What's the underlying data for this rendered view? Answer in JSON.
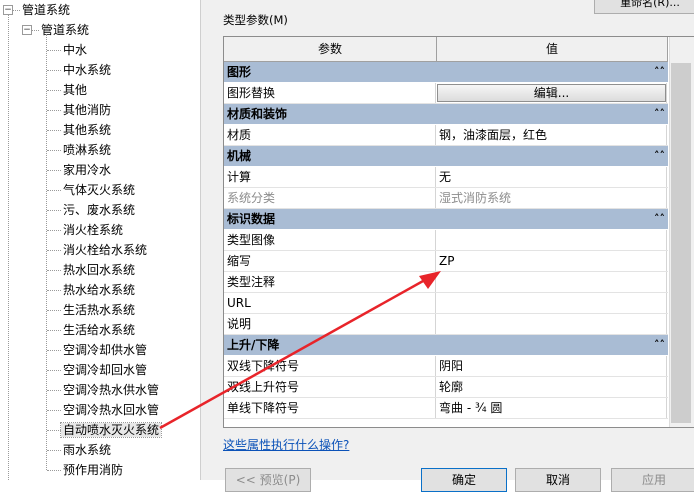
{
  "tree": {
    "root_label": "管道系统",
    "category_label": "管道系统",
    "items": [
      "中水",
      "中水系统",
      "其他",
      "其他消防",
      "其他系统",
      "喷淋系统",
      "家用冷水",
      "气体灭火系统",
      "污、废水系统",
      "消火栓系统",
      "消火栓给水系统",
      "热水回水系统",
      "热水给水系统",
      "生活热水系统",
      "生活给水系统",
      "空调冷却供水管",
      "空调冷却回水管",
      "空调冷热水供水管",
      "空调冷热水回水管",
      "自动喷水灭火系统",
      "雨水系统",
      "预作用消防"
    ],
    "selected_index": 19
  },
  "dialog": {
    "rename_button": "重命名(R)...",
    "type_params_label": "类型参数(M)",
    "grid": {
      "header_param": "参数",
      "header_value": "值",
      "header_extra": "=",
      "groups": [
        {
          "title": "图形",
          "rows": [
            {
              "param": "图形替换",
              "value": "编辑...",
              "is_button": true
            }
          ]
        },
        {
          "title": "材质和装饰",
          "rows": [
            {
              "param": "材质",
              "value": "钢，油漆面层，红色"
            }
          ]
        },
        {
          "title": "机械",
          "rows": [
            {
              "param": "计算",
              "value": "无"
            },
            {
              "param": "系统分类",
              "value": "湿式消防系统",
              "disabled": true
            }
          ]
        },
        {
          "title": "标识数据",
          "rows": [
            {
              "param": "类型图像",
              "value": ""
            },
            {
              "param": "缩写",
              "value": "ZP"
            },
            {
              "param": "类型注释",
              "value": ""
            },
            {
              "param": "URL",
              "value": ""
            },
            {
              "param": "说明",
              "value": ""
            }
          ]
        },
        {
          "title": "上升/下降",
          "rows": [
            {
              "param": "双线下降符号",
              "value": "阴阳"
            },
            {
              "param": "双线上升符号",
              "value": "轮廓"
            },
            {
              "param": "单线下降符号",
              "value": "弯曲 - ¾ 圆"
            }
          ]
        }
      ]
    },
    "help_link": "这些属性执行什么操作?",
    "buttons": {
      "preview": "<< 预览(P)",
      "ok": "确定",
      "cancel": "取消",
      "apply": "应用"
    }
  },
  "colors": {
    "group_header": "#a9bcd4",
    "arrow": "#e8242a",
    "link": "#0b52b8"
  }
}
